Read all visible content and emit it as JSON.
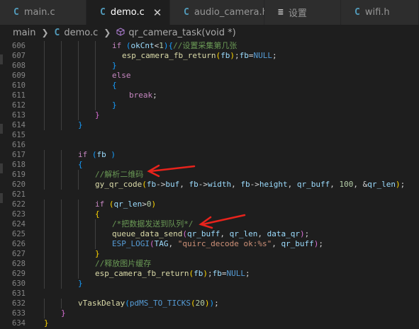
{
  "tabs": [
    {
      "icon": "C",
      "label": "main.c",
      "active": false
    },
    {
      "icon": "C",
      "label": "demo.c",
      "active": true,
      "close": "✕"
    },
    {
      "icon": "C",
      "label": "audio_camera.h",
      "active": false
    },
    {
      "icon": "≡",
      "label": "设置",
      "active": false
    },
    {
      "icon": "C",
      "label": "wifi.h",
      "active": false
    }
  ],
  "breadcrumb": {
    "folder": "main",
    "file_icon": "C",
    "file": "demo.c",
    "symbol": "qr_camera_task(void *)"
  },
  "lines": [
    {
      "n": "606",
      "indent": 96,
      "tokens": [
        [
          "cf",
          "if"
        ],
        [
          "pu",
          " "
        ],
        [
          "b3",
          "("
        ],
        [
          "var",
          "okCnt"
        ],
        [
          "pu",
          "<"
        ],
        [
          "num",
          "1"
        ],
        [
          "b3",
          ")"
        ],
        [
          "b3",
          "{"
        ],
        [
          "cm",
          "//设置采集第几张"
        ]
      ]
    },
    {
      "n": "607",
      "indent": 110,
      "tokens": [
        [
          "fn",
          "esp_camera_fb_return"
        ],
        [
          "b1",
          "("
        ],
        [
          "var",
          "fb"
        ],
        [
          "b1",
          ")"
        ],
        [
          "pu",
          ";"
        ],
        [
          "var",
          "fb"
        ],
        [
          "pu",
          "="
        ],
        [
          "mac",
          "NULL"
        ],
        [
          "pu",
          ";"
        ]
      ]
    },
    {
      "n": "608",
      "indent": 96,
      "tokens": [
        [
          "b3",
          "}"
        ]
      ]
    },
    {
      "n": "609",
      "indent": 96,
      "tokens": [
        [
          "cf",
          "else"
        ]
      ]
    },
    {
      "n": "610",
      "indent": 96,
      "tokens": [
        [
          "b3",
          "{"
        ]
      ]
    },
    {
      "n": "611",
      "indent": 120,
      "tokens": [
        [
          "cf",
          "break"
        ],
        [
          "pu",
          ";"
        ]
      ]
    },
    {
      "n": "612",
      "indent": 96,
      "tokens": [
        [
          "b3",
          "}"
        ]
      ]
    },
    {
      "n": "613",
      "indent": 72,
      "tokens": [
        [
          "b2",
          "}"
        ]
      ]
    },
    {
      "n": "614",
      "indent": 48,
      "tokens": [
        [
          "b3",
          "}"
        ]
      ]
    },
    {
      "n": "615",
      "indent": 0,
      "tokens": []
    },
    {
      "n": "616",
      "indent": 0,
      "tokens": []
    },
    {
      "n": "617",
      "indent": 48,
      "tokens": [
        [
          "cf",
          "if"
        ],
        [
          "pu",
          " "
        ],
        [
          "b3",
          "("
        ],
        [
          "var",
          "fb"
        ],
        [
          "pu",
          " "
        ],
        [
          "b3",
          ")"
        ]
      ]
    },
    {
      "n": "618",
      "indent": 48,
      "tokens": [
        [
          "b3",
          "{"
        ]
      ]
    },
    {
      "n": "619",
      "indent": 72,
      "tokens": [
        [
          "cm",
          "//解析二维码"
        ]
      ]
    },
    {
      "n": "620",
      "indent": 72,
      "tokens": [
        [
          "fn",
          "gy_qr_code"
        ],
        [
          "b1",
          "("
        ],
        [
          "var",
          "fb"
        ],
        [
          "pu",
          "->"
        ],
        [
          "var",
          "buf"
        ],
        [
          "pu",
          ", "
        ],
        [
          "var",
          "fb"
        ],
        [
          "pu",
          "->"
        ],
        [
          "var",
          "width"
        ],
        [
          "pu",
          ", "
        ],
        [
          "var",
          "fb"
        ],
        [
          "pu",
          "->"
        ],
        [
          "var",
          "height"
        ],
        [
          "pu",
          ", "
        ],
        [
          "var",
          "qr_buff"
        ],
        [
          "pu",
          ", "
        ],
        [
          "num",
          "100"
        ],
        [
          "pu",
          ", &"
        ],
        [
          "var",
          "qr_len"
        ],
        [
          "b1",
          ")"
        ],
        [
          "pu",
          ";"
        ]
      ]
    },
    {
      "n": "621",
      "indent": 0,
      "tokens": []
    },
    {
      "n": "622",
      "indent": 72,
      "tokens": [
        [
          "cf",
          "if"
        ],
        [
          "pu",
          " "
        ],
        [
          "b1",
          "("
        ],
        [
          "var",
          "qr_len"
        ],
        [
          "pu",
          ">"
        ],
        [
          "num",
          "0"
        ],
        [
          "b1",
          ")"
        ]
      ]
    },
    {
      "n": "623",
      "indent": 72,
      "tokens": [
        [
          "b1",
          "{"
        ]
      ]
    },
    {
      "n": "624",
      "indent": 96,
      "tokens": [
        [
          "cm",
          "/*把数据发送到队列*/"
        ]
      ]
    },
    {
      "n": "625",
      "indent": 96,
      "tokens": [
        [
          "fn",
          "queue_data_send"
        ],
        [
          "b2",
          "("
        ],
        [
          "var",
          "qr_buff"
        ],
        [
          "pu",
          ", "
        ],
        [
          "var",
          "qr_len"
        ],
        [
          "pu",
          ", "
        ],
        [
          "var",
          "data_qr"
        ],
        [
          "b2",
          ")"
        ],
        [
          "pu",
          ";"
        ]
      ]
    },
    {
      "n": "626",
      "indent": 96,
      "tokens": [
        [
          "mac",
          "ESP_LOGI"
        ],
        [
          "b2",
          "("
        ],
        [
          "var",
          "TAG"
        ],
        [
          "pu",
          ", "
        ],
        [
          "str",
          "\"quirc_decode ok:%s\""
        ],
        [
          "pu",
          ", "
        ],
        [
          "var",
          "qr_buff"
        ],
        [
          "b2",
          ")"
        ],
        [
          "pu",
          ";"
        ]
      ]
    },
    {
      "n": "627",
      "indent": 72,
      "tokens": [
        [
          "b1",
          "}"
        ]
      ]
    },
    {
      "n": "628",
      "indent": 72,
      "tokens": [
        [
          "cm",
          "//释放图片缓存"
        ]
      ]
    },
    {
      "n": "629",
      "indent": 72,
      "tokens": [
        [
          "fn",
          "esp_camera_fb_return"
        ],
        [
          "b1",
          "("
        ],
        [
          "var",
          "fb"
        ],
        [
          "b1",
          ")"
        ],
        [
          "pu",
          ";"
        ],
        [
          "var",
          "fb"
        ],
        [
          "pu",
          "="
        ],
        [
          "mac",
          "NULL"
        ],
        [
          "pu",
          ";"
        ]
      ]
    },
    {
      "n": "630",
      "indent": 48,
      "tokens": [
        [
          "b3",
          "}"
        ]
      ]
    },
    {
      "n": "631",
      "indent": 0,
      "tokens": []
    },
    {
      "n": "632",
      "indent": 48,
      "tokens": [
        [
          "fn",
          "vTaskDelay"
        ],
        [
          "b3",
          "("
        ],
        [
          "mac",
          "pdMS_TO_TICKS"
        ],
        [
          "b1",
          "("
        ],
        [
          "num",
          "20"
        ],
        [
          "b1",
          ")"
        ],
        [
          "b3",
          ")"
        ],
        [
          "pu",
          ";"
        ]
      ]
    },
    {
      "n": "633",
      "indent": 24,
      "tokens": [
        [
          "b2",
          "}"
        ]
      ]
    },
    {
      "n": "634",
      "indent": 0,
      "tokens": [
        [
          "b1",
          "}"
        ]
      ]
    }
  ],
  "colors": {
    "arrow": "#e8231c",
    "editor_bg": "#1e1e1e",
    "tabbar_bg": "#252526"
  }
}
